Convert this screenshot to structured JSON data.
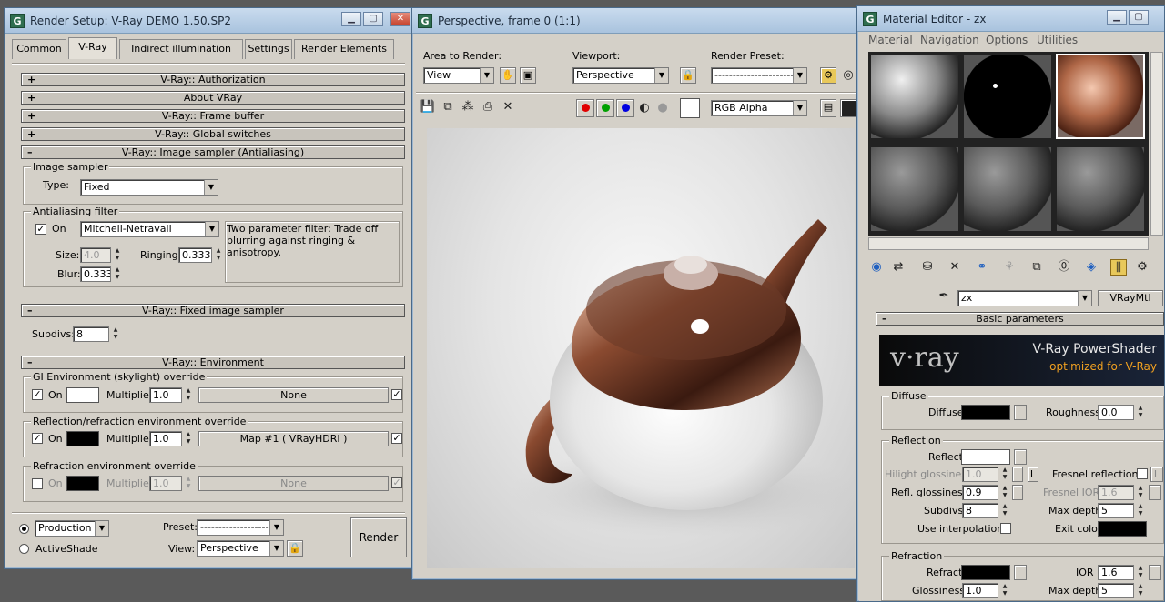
{
  "render_setup": {
    "title": "Render Setup: V-Ray DEMO 1.50.SP2",
    "tabs": [
      "Common",
      "V-Ray",
      "Indirect illumination",
      "Settings",
      "Render Elements"
    ],
    "rollups": {
      "authorization": "V-Ray:: Authorization",
      "about": "About VRay",
      "frame_buffer": "V-Ray:: Frame buffer",
      "global_switches": "V-Ray:: Global switches",
      "image_sampler": "V-Ray:: Image sampler (Antialiasing)",
      "fixed_sampler": "V-Ray:: Fixed image sampler",
      "environment": "V-Ray:: Environment"
    },
    "plus": "+",
    "minus": "–",
    "image_sampler": {
      "group_label": "Image sampler",
      "type_label": "Type:",
      "type_value": "Fixed"
    },
    "aa_filter": {
      "group_label": "Antialiasing filter",
      "on_label": "On",
      "filter_value": "Mitchell-Netravali",
      "description": "Two parameter filter: Trade off blurring against ringing & anisotropy.",
      "size_label": "Size:",
      "size_value": "4.0",
      "ringing_label": "Ringing:",
      "ringing_value": "0.333",
      "blur_label": "Blur:",
      "blur_value": "0.333"
    },
    "fixed": {
      "subdivs_label": "Subdivs:",
      "subdivs_value": "8"
    },
    "gi_env": {
      "group_label": "GI Environment (skylight) override",
      "on_label": "On",
      "multiplier_label": "Multiplier:",
      "multiplier_value": "1.0",
      "map_label": "None",
      "swatch": "#ffffff"
    },
    "refl_env": {
      "group_label": "Reflection/refraction environment override",
      "on_label": "On",
      "multiplier_label": "Multiplier:",
      "multiplier_value": "1.0",
      "map_label": "Map #1  ( VRayHDRI )",
      "swatch": "#000000"
    },
    "refr_env": {
      "group_label": "Refraction environment override",
      "on_label": "On",
      "multiplier_label": "Multiplier:",
      "multiplier_value": "1.0",
      "map_label": "None",
      "swatch": "#000000"
    },
    "bottom": {
      "production": "Production",
      "activeshade": "ActiveShade",
      "preset_label": "Preset:",
      "preset_value": "---------------------",
      "view_label": "View:",
      "view_value": "Perspective",
      "render_button": "Render"
    }
  },
  "frame_window": {
    "title": "Perspective, frame 0 (1:1)",
    "area_label": "Area to Render:",
    "area_value": "View",
    "viewport_label": "Viewport:",
    "viewport_value": "Perspective",
    "preset_label": "Render Preset:",
    "preset_value": "------------------------",
    "channel_value": "RGB Alpha",
    "channel_colors": [
      "#e00000",
      "#00a000",
      "#0000e0"
    ]
  },
  "material_editor": {
    "title": "Material Editor - zx",
    "menu": [
      "Material",
      "Navigation",
      "Options",
      "Utilities"
    ],
    "material_name": "zx",
    "material_type": "VRayMtl",
    "basic_params": "Basic parameters",
    "logo_text": "v·ray",
    "powershader": "V-Ray PowerShader",
    "optimized": "optimized for V-Ray",
    "diffuse_group": "Diffuse",
    "diffuse_label": "Diffuse",
    "diffuse_color": "#000000",
    "roughness_label": "Roughness",
    "roughness_value": "0.0",
    "reflection_group": "Reflection",
    "reflect_label": "Reflect",
    "reflect_color": "#ffffff",
    "hilight_label": "Hilight glossiness",
    "hilight_value": "1.0",
    "l_label": "L",
    "fresnel_label": "Fresnel reflections",
    "refl_gloss_label": "Refl. glossiness",
    "refl_gloss_value": "0.9",
    "fresnel_ior_label": "Fresnel IOR",
    "fresnel_ior_value": "1.6",
    "subdivs_label": "Subdivs",
    "subdivs_value": "8",
    "max_depth_label": "Max depth",
    "max_depth_value": "5",
    "use_interp_label": "Use interpolation",
    "exit_color_label": "Exit color",
    "exit_color": "#000000",
    "refraction_group": "Refraction",
    "refract_label": "Refract",
    "refract_color": "#000000",
    "ior_label": "IOR",
    "ior_value": "1.6",
    "glossiness_label": "Glossiness",
    "glossiness_value": "1.0",
    "max_depth2_label": "Max depth",
    "max_depth2_value": "5"
  }
}
